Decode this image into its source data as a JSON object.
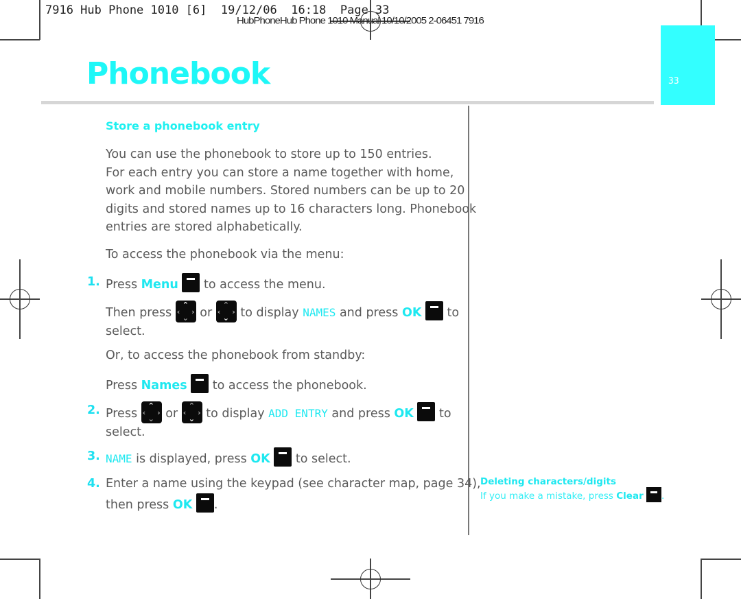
{
  "slug": {
    "line1": "7916 Hub Phone 1010 [6]  19/12/06  16:18  Page 33",
    "line2": "HubPhoneHub Phone 1010 Manual 10/10/2005 2-06451 7916"
  },
  "header": {
    "title": "Phonebook",
    "page_tab_number": "33",
    "tab_color": "#33ffff",
    "accent_color": "#1ef0f0"
  },
  "section": {
    "heading": "Store a phonebook entry",
    "intro_lines": [
      "You can use the phonebook to store up to 150 entries.",
      "For each entry you can store a name together with home,",
      "work and mobile numbers. Stored numbers can be up to 20",
      "digits and stored names up to 16 characters long. Phonebook",
      "entries are stored alphabetically."
    ],
    "via_menu": "To access the phonebook via the menu:",
    "steps": {
      "s1": {
        "number": "1.",
        "a_press": "Press",
        "a_key": "Menu",
        "a_rest": "to access the menu.",
        "b_then": "Then press",
        "b_or": "or",
        "b_display": "to display",
        "b_lcd": "NAMES",
        "b_andpress": "and press",
        "b_key": "OK",
        "b_to": "to",
        "b_select": "select."
      },
      "standby_intro": "Or, to access the phonebook from standby:",
      "standby": {
        "press": "Press",
        "key": "Names",
        "rest": "to access the phonebook."
      },
      "s2": {
        "number": "2.",
        "press": "Press",
        "or": "or",
        "display": "to display",
        "lcd": "ADD ENTRY",
        "andpress": "and press",
        "key": "OK",
        "to": "to",
        "select": "select."
      },
      "s3": {
        "number": "3.",
        "lcd": "NAME",
        "text": "is displayed, press",
        "key": "OK",
        "rest": "to select."
      },
      "s4": {
        "number": "4.",
        "line1": "Enter a name using the keypad (see character map, page 34),",
        "then_press": "then press",
        "key": "OK",
        "end": "."
      }
    }
  },
  "sidebar_tip": {
    "heading": "Deleting characters/digits",
    "text": "If you make a mistake, press",
    "key": "Clear",
    "end": "."
  },
  "icons": {
    "softkey": "softkey-dash-icon",
    "navigation": "navigation-pad-icon"
  }
}
